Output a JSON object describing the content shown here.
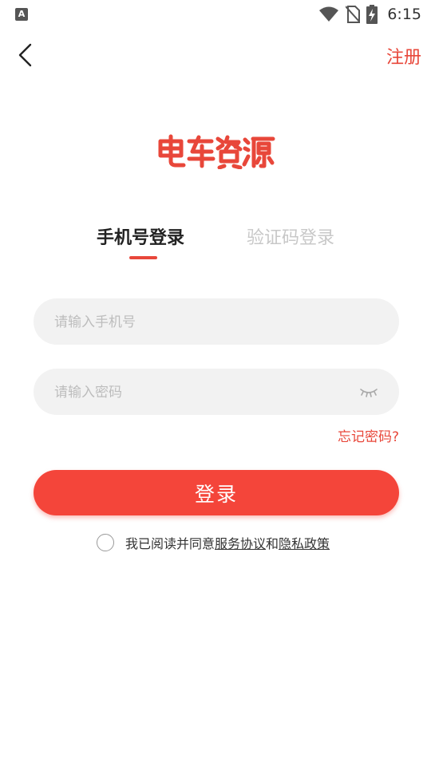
{
  "status_bar": {
    "notification_letter": "A",
    "time": "6:15"
  },
  "header": {
    "register_label": "注册"
  },
  "logo": {
    "text": "电车资源",
    "color": "#e8473a"
  },
  "tabs": [
    {
      "label": "手机号登录",
      "active": true
    },
    {
      "label": "验证码登录",
      "active": false
    }
  ],
  "form": {
    "phone_placeholder": "请输入手机号",
    "password_placeholder": "请输入密码",
    "forgot_label": "忘记密码?",
    "login_label": "登录"
  },
  "agreement": {
    "prefix": "我已阅读并同意",
    "service_link": "服务协议",
    "conjunction": "和",
    "privacy_link": "隐私政策",
    "checked": false
  },
  "colors": {
    "accent": "#f4453a",
    "field_bg": "#f2f2f2",
    "placeholder": "#bdbdbd"
  }
}
